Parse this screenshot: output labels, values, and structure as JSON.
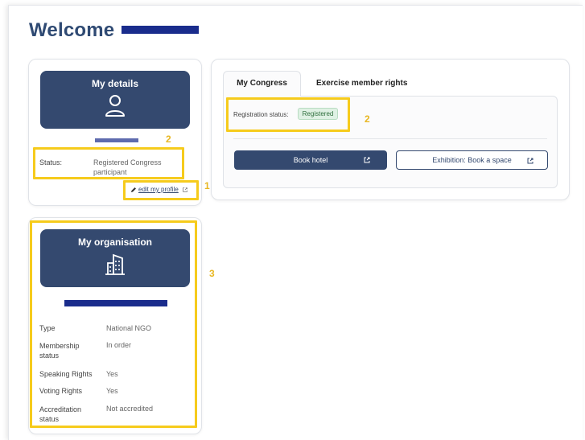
{
  "header": {
    "welcome": "Welcome"
  },
  "my_details": {
    "title": "My details",
    "status_label": "Status:",
    "status_value": "Registered Congress participant",
    "edit_link": "edit my profile",
    "annotation_status": "2",
    "annotation_edit": "1"
  },
  "congress": {
    "tabs": [
      {
        "label": "My Congress",
        "active": true
      },
      {
        "label": "Exercise member rights",
        "active": false
      }
    ],
    "registration_label": "Registration status:",
    "registration_badge": "Registered",
    "annotation": "2",
    "book_hotel": "Book hotel",
    "exhibition": "Exhibition: Book a space"
  },
  "organisation": {
    "title": "My organisation",
    "annotation": "3",
    "rows": [
      {
        "label": "Type",
        "value": "National NGO"
      },
      {
        "label": "Membership status",
        "value": "In order"
      },
      {
        "label": "Speaking Rights",
        "value": "Yes"
      },
      {
        "label": "Voting Rights",
        "value": "Yes"
      },
      {
        "label": "Accreditation status",
        "value": "Not accredited"
      }
    ]
  },
  "colors": {
    "primary": "#34496f",
    "title": "#2f4a73",
    "highlight": "#f6cb1c",
    "annotation": "#e8b722",
    "badge_bg": "#dff1e4",
    "redaction": "#1a2c8c"
  },
  "icons": {
    "user": "user-outline-icon",
    "building": "building-icon",
    "external": "external-link-icon",
    "pencil": "pencil-icon"
  }
}
